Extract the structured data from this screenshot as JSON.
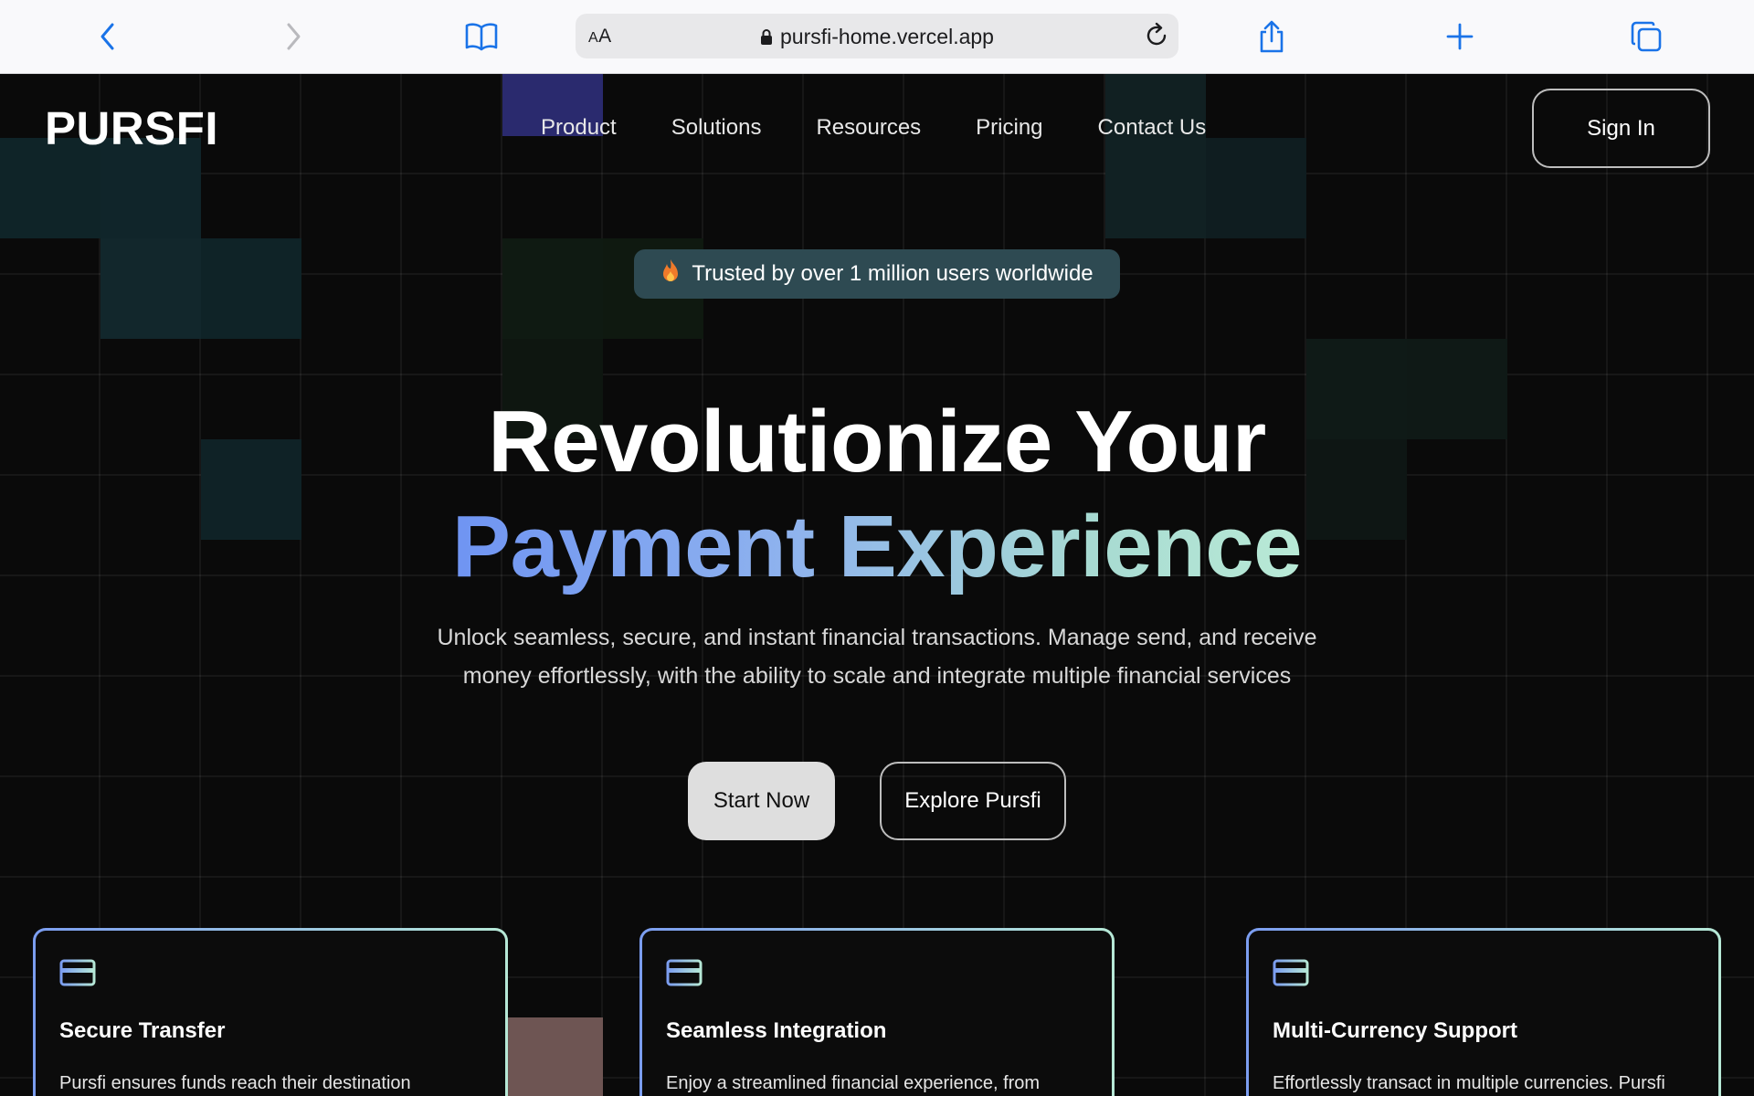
{
  "browser": {
    "text_size_label": "AA",
    "url": "pursfi-home.vercel.app"
  },
  "header": {
    "logo": "PURSFI",
    "nav": [
      "Product",
      "Solutions",
      "Resources",
      "Pricing",
      "Contact Us"
    ],
    "sign_in": "Sign In"
  },
  "hero": {
    "badge": "Trusted by over 1 million users worldwide",
    "title_line1": "Revolutionize Your",
    "title_line2": "Payment Experience",
    "subtitle_line1": "Unlock seamless, secure, and instant financial transactions. Manage send, and receive",
    "subtitle_line2": "money effortlessly, with the ability to scale and integrate multiple financial services",
    "cta_primary": "Start Now",
    "cta_secondary": "Explore Pursfi"
  },
  "features": [
    {
      "title": "Secure Transfer",
      "text": "Pursfi ensures funds reach their destination",
      "icon": "credit-card-icon"
    },
    {
      "title": "Seamless Integration",
      "text": "Enjoy a streamlined financial experience, from",
      "icon": "credit-card-icon"
    },
    {
      "title": "Multi-Currency Support",
      "text": "Effortlessly transact in multiple currencies. Pursfi",
      "icon": "credit-card-icon"
    }
  ],
  "colors": {
    "accent_gradient_start": "#6f94f2",
    "accent_gradient_end": "#b9ead6",
    "badge_bg": "#2e4a52",
    "safari_blue": "#1a73e8"
  }
}
